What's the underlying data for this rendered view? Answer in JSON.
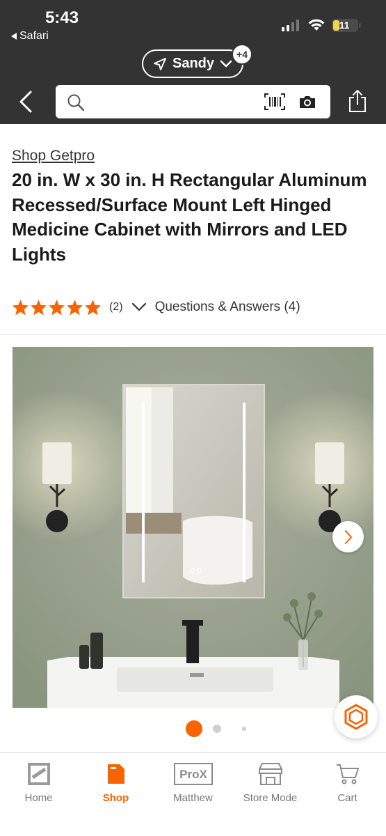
{
  "status_bar": {
    "time": "5:43",
    "back_app": "Safari",
    "battery_level": "11"
  },
  "header": {
    "location": "Sandy",
    "location_badge": "+4",
    "search_placeholder": ""
  },
  "product": {
    "brand": "Shop Getpro",
    "title": "20 in. W x 30 in. H Rectangular Aluminum Recessed/Surface Mount Left Hinged Medicine Cabinet with Mirrors and LED Lights",
    "rating": 5,
    "review_count": "(2)",
    "qa_label": "Questions & Answers (4)"
  },
  "gallery": {
    "image_count": 3,
    "active_index": 0
  },
  "tabbar": {
    "items": [
      {
        "label": "Home",
        "icon": "home-depot-logo-icon"
      },
      {
        "label": "Shop",
        "icon": "shop-tag-icon",
        "active": true
      },
      {
        "label": "Matthew",
        "icon": "prox-icon",
        "text": "ProX"
      },
      {
        "label": "Store Mode",
        "icon": "store-icon"
      },
      {
        "label": "Cart",
        "icon": "cart-icon"
      }
    ]
  },
  "colors": {
    "brand_orange": "#F96302",
    "header_bg": "#333333"
  }
}
